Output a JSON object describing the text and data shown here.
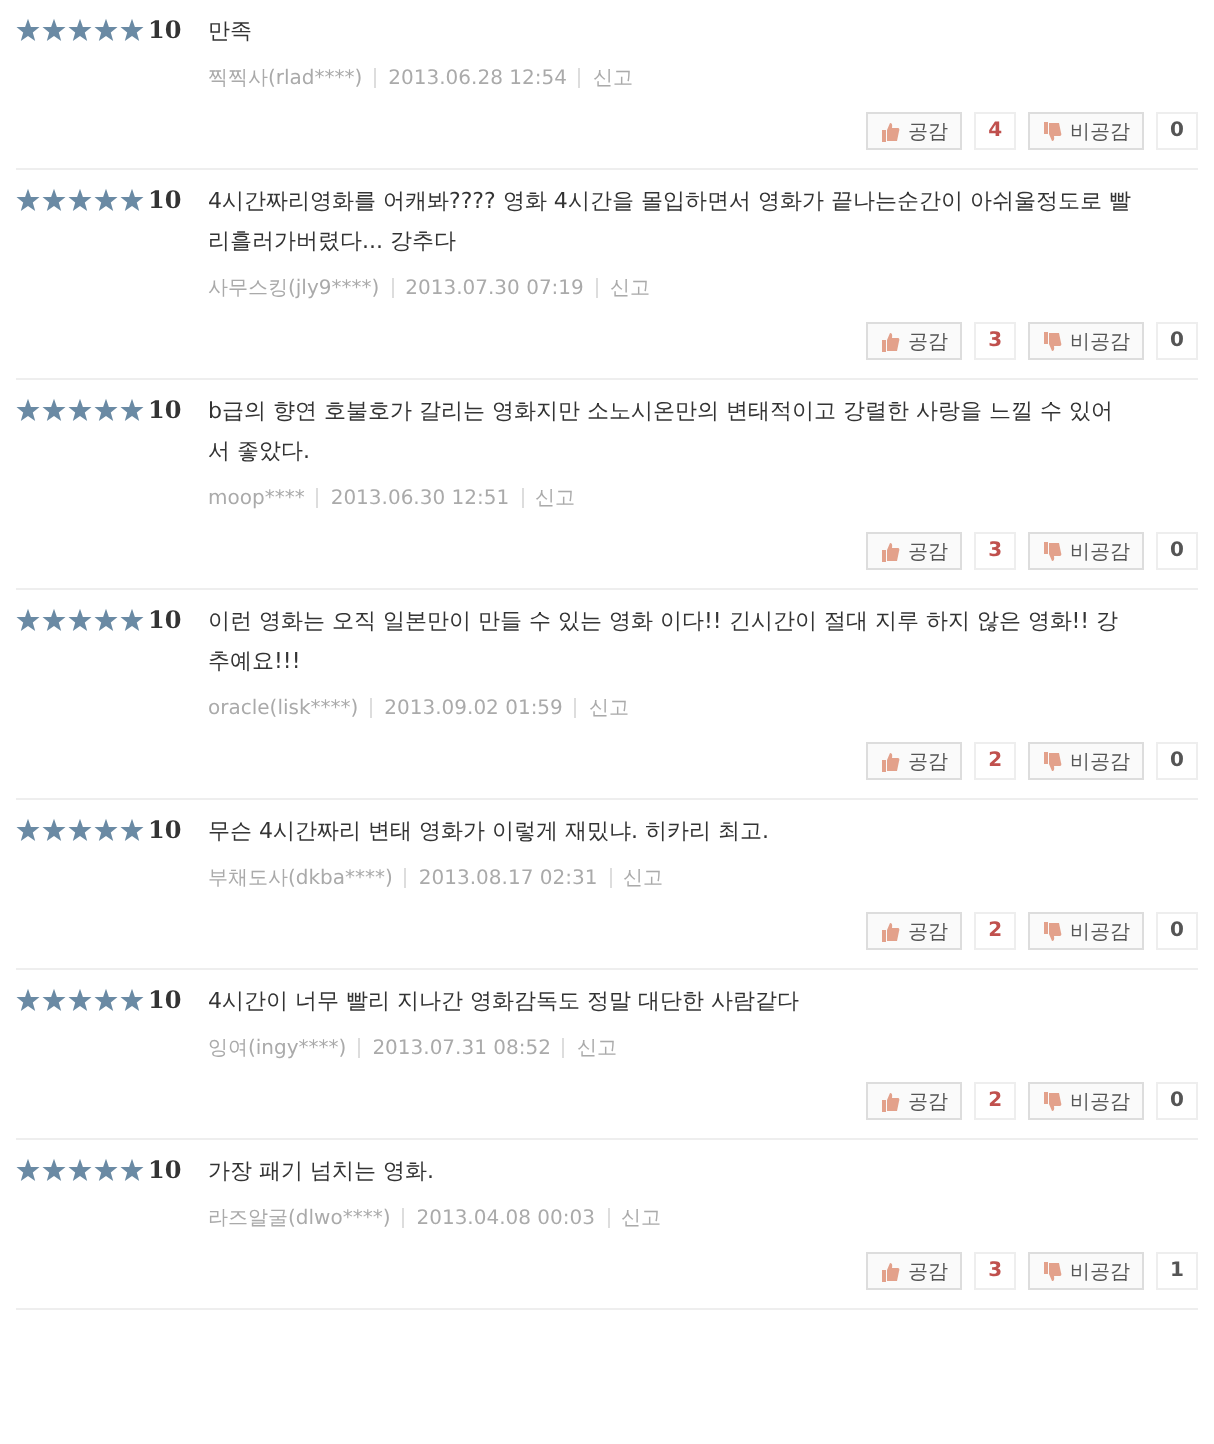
{
  "reviews": [
    {
      "stars": 5,
      "score": "10",
      "text": "만족",
      "author": "찍찍사(rlad****)",
      "date": "2013.06.28 12:54",
      "report": "신고",
      "like_label": "공감",
      "likes": "4",
      "dislike_label": "비공감",
      "dislikes": "0"
    },
    {
      "stars": 5,
      "score": "10",
      "text": "4시간짜리영화를 어캐봐???? 영화 4시간을 몰입하면서 영화가 끝나는순간이 아쉬울정도로 빨리흘러가버렸다... 강추다",
      "author": "사무스킹(jly9****)",
      "date": "2013.07.30 07:19",
      "report": "신고",
      "like_label": "공감",
      "likes": "3",
      "dislike_label": "비공감",
      "dislikes": "0"
    },
    {
      "stars": 5,
      "score": "10",
      "text": "b급의 향연 호불호가 갈리는 영화지만 소노시온만의 변태적이고 강렬한 사랑을 느낄 수 있어서 좋았다.",
      "author": "moop****",
      "date": "2013.06.30 12:51",
      "report": "신고",
      "like_label": "공감",
      "likes": "3",
      "dislike_label": "비공감",
      "dislikes": "0"
    },
    {
      "stars": 5,
      "score": "10",
      "text": "이런 영화는 오직 일본만이 만들 수 있는 영화 이다!! 긴시간이 절대 지루 하지 않은 영화!! 강추예요!!!",
      "author": "oracle(lisk****)",
      "date": "2013.09.02 01:59",
      "report": "신고",
      "like_label": "공감",
      "likes": "2",
      "dislike_label": "비공감",
      "dislikes": "0"
    },
    {
      "stars": 5,
      "score": "10",
      "text": "무슨 4시간짜리 변태 영화가 이렇게 재밌냐. 히카리 최고.",
      "author": "부채도사(dkba****)",
      "date": "2013.08.17 02:31",
      "report": "신고",
      "like_label": "공감",
      "likes": "2",
      "dislike_label": "비공감",
      "dislikes": "0"
    },
    {
      "stars": 5,
      "score": "10",
      "text": "4시간이 너무 빨리 지나간 영화감독도 정말 대단한 사람같다",
      "author": "잉여(ingy****)",
      "date": "2013.07.31 08:52",
      "report": "신고",
      "like_label": "공감",
      "likes": "2",
      "dislike_label": "비공감",
      "dislikes": "0"
    },
    {
      "stars": 5,
      "score": "10",
      "text": "가장 패기 넘치는 영화.",
      "author": "라즈알굴(dlwo****)",
      "date": "2013.04.08 00:03",
      "report": "신고",
      "like_label": "공감",
      "likes": "3",
      "dislike_label": "비공감",
      "dislikes": "1"
    }
  ]
}
